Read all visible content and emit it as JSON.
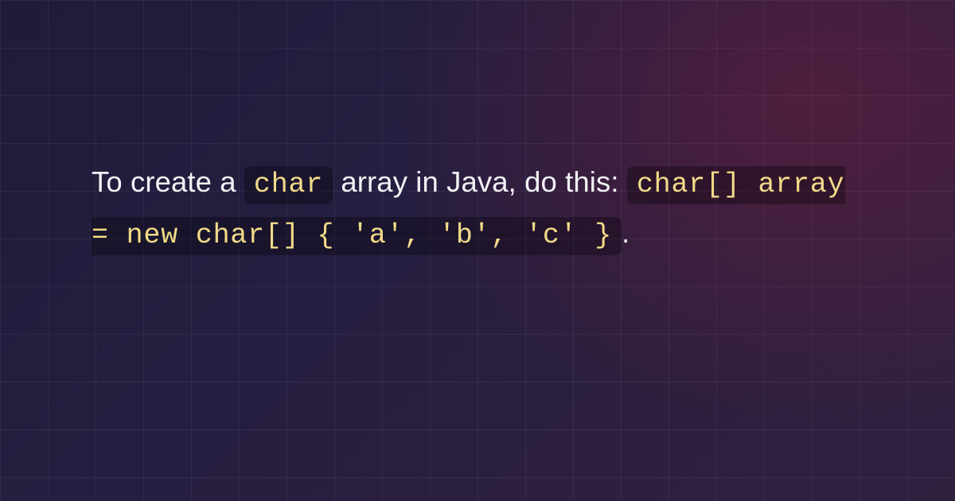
{
  "text": {
    "part1": "To create a ",
    "code1": "char",
    "part2": " array in Java, do this: ",
    "code2": "char[] array = new char[] { 'a', 'b', 'c' }",
    "part3": "."
  },
  "colors": {
    "code_text": "#f2da89",
    "body_text": "#f2f2f5",
    "bg_base": "#251e40"
  }
}
